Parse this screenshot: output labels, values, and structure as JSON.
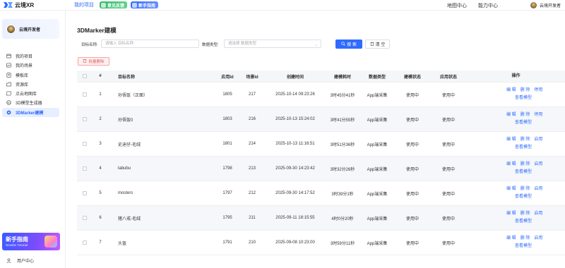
{
  "brand": {
    "name": "云境XR"
  },
  "topnav": {
    "my_projects": "我的项目",
    "feedback": "意见反馈",
    "guide": "新手指南",
    "map_center": "地图中心",
    "ability_center": "能力中心",
    "username": "云境开发者"
  },
  "sidebar": {
    "user_name": "云境开发者",
    "items": [
      {
        "label": "我的项目",
        "icon": "project-icon"
      },
      {
        "label": "我的场景",
        "icon": "scene-icon"
      },
      {
        "label": "模板库",
        "icon": "template-icon"
      },
      {
        "label": "资源库",
        "icon": "resource-icon"
      },
      {
        "label": "点云地图库",
        "icon": "pointcloud-icon"
      },
      {
        "label": "3D模型生成器",
        "icon": "model-generator-icon"
      },
      {
        "label": "3DMarker建模",
        "icon": "marker-icon"
      }
    ],
    "active_index": 6,
    "banner_title": "新手指南",
    "banner_sub": "Newbie Tutorial",
    "user_center": "用户中心"
  },
  "page": {
    "title": "3DMarker建模",
    "filter": {
      "name_label": "目标名称:",
      "name_placeholder": "请输入 目标名称",
      "type_label": "数据类型:",
      "type_placeholder": "请选择 数据类型",
      "search_btn": "搜 索",
      "reset_btn": "清 空"
    },
    "batch_delete": "批量删除"
  },
  "table": {
    "headers": [
      "#",
      "目标名称",
      "应用Id",
      "场景Id",
      "创建时间",
      "建模耗时",
      "数据类型",
      "建模状态",
      "应用状态",
      "操作"
    ],
    "rows": [
      {
        "idx": "1",
        "name": "孙悟饭（正面）",
        "app": "1805",
        "scene": "217",
        "time": "2025-10-14 09:23:26",
        "dur": "3时45分41秒",
        "type": "App端采集",
        "build": "使用中",
        "appst": "使用中",
        "ops": [
          "编 辑",
          "删 除",
          "停用"
        ],
        "view": "查看模型"
      },
      {
        "idx": "2",
        "name": "孙悟饭0",
        "app": "1803",
        "scene": "216",
        "time": "2025-10-13 15:24:02",
        "dur": "3时41分55秒",
        "type": "App端采集",
        "build": "使用中",
        "appst": "使用中",
        "ops": [
          "编 辑",
          "删 除",
          "停用"
        ],
        "view": "查看模型"
      },
      {
        "idx": "3",
        "name": "史迪仔-毛绒",
        "app": "1801",
        "scene": "214",
        "time": "2025-10-13 11:16:51",
        "dur": "3时51分36秒",
        "type": "App端采集",
        "build": "使用中",
        "appst": "使用中",
        "ops": [
          "编 辑",
          "删 除",
          "启用"
        ],
        "view": "查看模型"
      },
      {
        "idx": "4",
        "name": "labubu",
        "app": "1798",
        "scene": "213",
        "time": "2025-09-30 14:23:42",
        "dur": "3时32分26秒",
        "type": "App端采集",
        "build": "使用中",
        "appst": "使用中",
        "ops": [
          "编 辑",
          "删 除",
          "启用"
        ],
        "view": "查看模型"
      },
      {
        "idx": "5",
        "name": "mosters",
        "app": "1797",
        "scene": "212",
        "time": "2025-09-30 14:17:52",
        "dur": "3时39分1秒",
        "type": "App端采集",
        "build": "使用中",
        "appst": "使用中",
        "ops": [
          "编 辑",
          "删 除",
          "启用"
        ],
        "view": "查看模型"
      },
      {
        "idx": "6",
        "name": "猪八戒-毛绒",
        "app": "1795",
        "scene": "211",
        "time": "2025-09-11 18:15:55",
        "dur": "4时0分20秒",
        "type": "App端采集",
        "build": "使用中",
        "appst": "使用中",
        "ops": [
          "编 辑",
          "删 除",
          "启用"
        ],
        "view": "查看模型"
      },
      {
        "idx": "7",
        "name": "头盔",
        "app": "1791",
        "scene": "210",
        "time": "2025-09-08 10:23:00",
        "dur": "3时59分11秒",
        "type": "App端采集",
        "build": "使用中",
        "appst": "使用中",
        "ops": [
          "编 辑",
          "删 除",
          "启用"
        ],
        "view": "查看模型"
      }
    ]
  },
  "colors": {
    "accent": "#2f6bff",
    "danger": "#e05a5a"
  }
}
